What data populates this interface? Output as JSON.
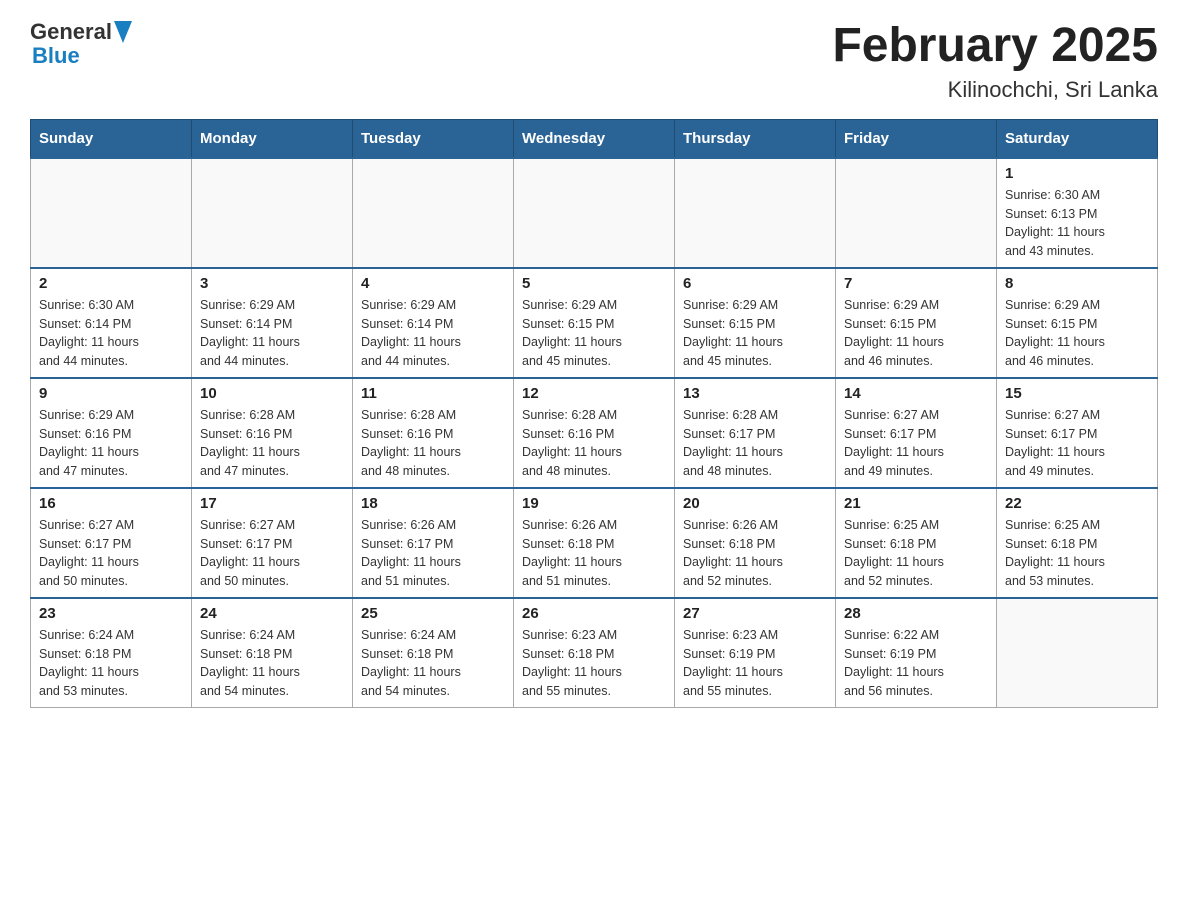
{
  "logo": {
    "text_general": "General",
    "text_blue": "Blue"
  },
  "title": "February 2025",
  "subtitle": "Kilinochchi, Sri Lanka",
  "days_of_week": [
    "Sunday",
    "Monday",
    "Tuesday",
    "Wednesday",
    "Thursday",
    "Friday",
    "Saturday"
  ],
  "weeks": [
    [
      {
        "day": "",
        "info": ""
      },
      {
        "day": "",
        "info": ""
      },
      {
        "day": "",
        "info": ""
      },
      {
        "day": "",
        "info": ""
      },
      {
        "day": "",
        "info": ""
      },
      {
        "day": "",
        "info": ""
      },
      {
        "day": "1",
        "info": "Sunrise: 6:30 AM\nSunset: 6:13 PM\nDaylight: 11 hours\nand 43 minutes."
      }
    ],
    [
      {
        "day": "2",
        "info": "Sunrise: 6:30 AM\nSunset: 6:14 PM\nDaylight: 11 hours\nand 44 minutes."
      },
      {
        "day": "3",
        "info": "Sunrise: 6:29 AM\nSunset: 6:14 PM\nDaylight: 11 hours\nand 44 minutes."
      },
      {
        "day": "4",
        "info": "Sunrise: 6:29 AM\nSunset: 6:14 PM\nDaylight: 11 hours\nand 44 minutes."
      },
      {
        "day": "5",
        "info": "Sunrise: 6:29 AM\nSunset: 6:15 PM\nDaylight: 11 hours\nand 45 minutes."
      },
      {
        "day": "6",
        "info": "Sunrise: 6:29 AM\nSunset: 6:15 PM\nDaylight: 11 hours\nand 45 minutes."
      },
      {
        "day": "7",
        "info": "Sunrise: 6:29 AM\nSunset: 6:15 PM\nDaylight: 11 hours\nand 46 minutes."
      },
      {
        "day": "8",
        "info": "Sunrise: 6:29 AM\nSunset: 6:15 PM\nDaylight: 11 hours\nand 46 minutes."
      }
    ],
    [
      {
        "day": "9",
        "info": "Sunrise: 6:29 AM\nSunset: 6:16 PM\nDaylight: 11 hours\nand 47 minutes."
      },
      {
        "day": "10",
        "info": "Sunrise: 6:28 AM\nSunset: 6:16 PM\nDaylight: 11 hours\nand 47 minutes."
      },
      {
        "day": "11",
        "info": "Sunrise: 6:28 AM\nSunset: 6:16 PM\nDaylight: 11 hours\nand 48 minutes."
      },
      {
        "day": "12",
        "info": "Sunrise: 6:28 AM\nSunset: 6:16 PM\nDaylight: 11 hours\nand 48 minutes."
      },
      {
        "day": "13",
        "info": "Sunrise: 6:28 AM\nSunset: 6:17 PM\nDaylight: 11 hours\nand 48 minutes."
      },
      {
        "day": "14",
        "info": "Sunrise: 6:27 AM\nSunset: 6:17 PM\nDaylight: 11 hours\nand 49 minutes."
      },
      {
        "day": "15",
        "info": "Sunrise: 6:27 AM\nSunset: 6:17 PM\nDaylight: 11 hours\nand 49 minutes."
      }
    ],
    [
      {
        "day": "16",
        "info": "Sunrise: 6:27 AM\nSunset: 6:17 PM\nDaylight: 11 hours\nand 50 minutes."
      },
      {
        "day": "17",
        "info": "Sunrise: 6:27 AM\nSunset: 6:17 PM\nDaylight: 11 hours\nand 50 minutes."
      },
      {
        "day": "18",
        "info": "Sunrise: 6:26 AM\nSunset: 6:17 PM\nDaylight: 11 hours\nand 51 minutes."
      },
      {
        "day": "19",
        "info": "Sunrise: 6:26 AM\nSunset: 6:18 PM\nDaylight: 11 hours\nand 51 minutes."
      },
      {
        "day": "20",
        "info": "Sunrise: 6:26 AM\nSunset: 6:18 PM\nDaylight: 11 hours\nand 52 minutes."
      },
      {
        "day": "21",
        "info": "Sunrise: 6:25 AM\nSunset: 6:18 PM\nDaylight: 11 hours\nand 52 minutes."
      },
      {
        "day": "22",
        "info": "Sunrise: 6:25 AM\nSunset: 6:18 PM\nDaylight: 11 hours\nand 53 minutes."
      }
    ],
    [
      {
        "day": "23",
        "info": "Sunrise: 6:24 AM\nSunset: 6:18 PM\nDaylight: 11 hours\nand 53 minutes."
      },
      {
        "day": "24",
        "info": "Sunrise: 6:24 AM\nSunset: 6:18 PM\nDaylight: 11 hours\nand 54 minutes."
      },
      {
        "day": "25",
        "info": "Sunrise: 6:24 AM\nSunset: 6:18 PM\nDaylight: 11 hours\nand 54 minutes."
      },
      {
        "day": "26",
        "info": "Sunrise: 6:23 AM\nSunset: 6:18 PM\nDaylight: 11 hours\nand 55 minutes."
      },
      {
        "day": "27",
        "info": "Sunrise: 6:23 AM\nSunset: 6:19 PM\nDaylight: 11 hours\nand 55 minutes."
      },
      {
        "day": "28",
        "info": "Sunrise: 6:22 AM\nSunset: 6:19 PM\nDaylight: 11 hours\nand 56 minutes."
      },
      {
        "day": "",
        "info": ""
      }
    ]
  ]
}
